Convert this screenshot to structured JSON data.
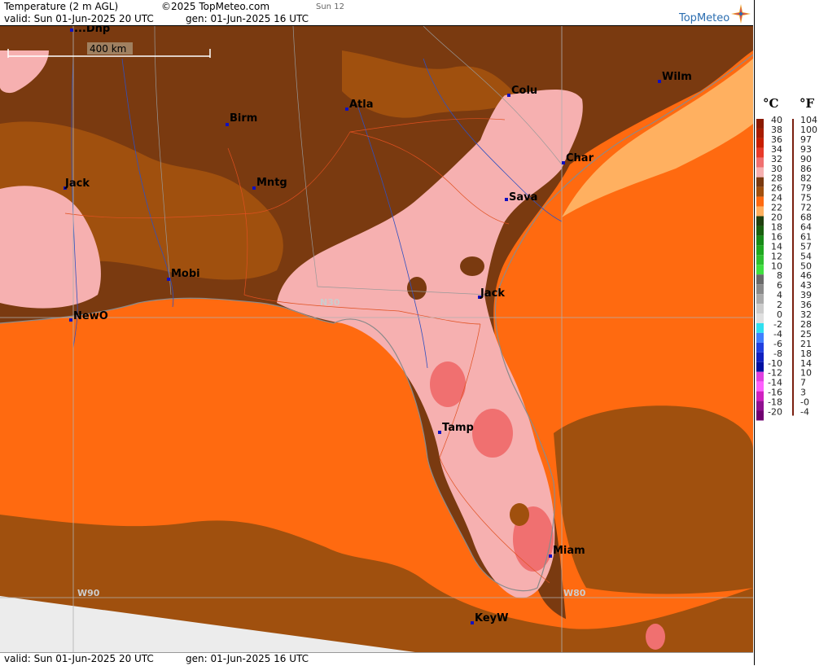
{
  "header": {
    "title": "Temperature (2 m AGL)",
    "copyright": "©2025 TopMeteo.com",
    "run_tag": "Sun 12",
    "valid": "valid:  Sun  01-Jun-2025  20 UTC",
    "gen": "gen: 01-Jun-2025 16 UTC",
    "logo_text": "TopMeteo"
  },
  "footer": {
    "valid": "valid:  Sun  01-Jun-2025  20 UTC",
    "gen": "gen: 01-Jun-2025 16 UTC"
  },
  "scale_bar": {
    "label": "400 km"
  },
  "grid_labels": {
    "n30": "N30",
    "w90": "W90",
    "w80": "W80"
  },
  "cities": {
    "top": "...Dhp",
    "wilm": "Wilm",
    "colu": "Colu",
    "atla": "Atla",
    "birm": "Birm",
    "char": "Char",
    "jack_ms": "Jack",
    "mntg": "Mntg",
    "sava": "Sava",
    "mobi": "Mobi",
    "jack_fl": "Jack",
    "newo": "NewO",
    "tamp": "Tamp",
    "miam": "Miam",
    "keyw": "KeyW"
  },
  "legend": {
    "c_header": "°C",
    "f_header": "°F",
    "c_labels": [
      "40",
      "38",
      "36",
      "34",
      "32",
      "30",
      "28",
      "26",
      "24",
      "22",
      "20",
      "18",
      "16",
      "14",
      "12",
      "10",
      "8",
      "6",
      "4",
      "2",
      "0",
      "-2",
      "-4",
      "-6",
      "-8",
      "-10",
      "-12",
      "-14",
      "-16",
      "-18",
      "-20"
    ],
    "f_labels": [
      "104",
      "100",
      "97",
      "93",
      "90",
      "86",
      "82",
      "79",
      "75",
      "72",
      "68",
      "64",
      "61",
      "57",
      "54",
      "50",
      "46",
      "43",
      "39",
      "36",
      "32",
      "28",
      "25",
      "21",
      "18",
      "14",
      "10",
      "7",
      "3",
      "-0",
      "-4"
    ],
    "colors": [
      "#8b1a00",
      "#a81c00",
      "#c81e00",
      "#e83a2a",
      "#f07070",
      "#f6b0b0",
      "#7a3a10",
      "#a0500e",
      "#ff6a10",
      "#ffb060",
      "#204010",
      "#1a6010",
      "#188a18",
      "#20a820",
      "#30c030",
      "#40e040",
      "#6a6a6a",
      "#8a8a8a",
      "#aaaaaa",
      "#cccccc",
      "#e0e0e0",
      "#30e0f0",
      "#4080ff",
      "#2040e0",
      "#1020c0",
      "#0010a0",
      "#e040e0",
      "#ff60ff",
      "#d020c0",
      "#901090",
      "#700070"
    ]
  },
  "colors": {
    "land_warm": "#7a3a10",
    "land_mid": "#a0500e",
    "sea_orange": "#ff6a10",
    "florida_pink": "#f6b0b0",
    "hot_spot": "#f07070",
    "light_orange": "#ffb060",
    "no_data": "#ececec",
    "city_marker": "#1010c0"
  }
}
